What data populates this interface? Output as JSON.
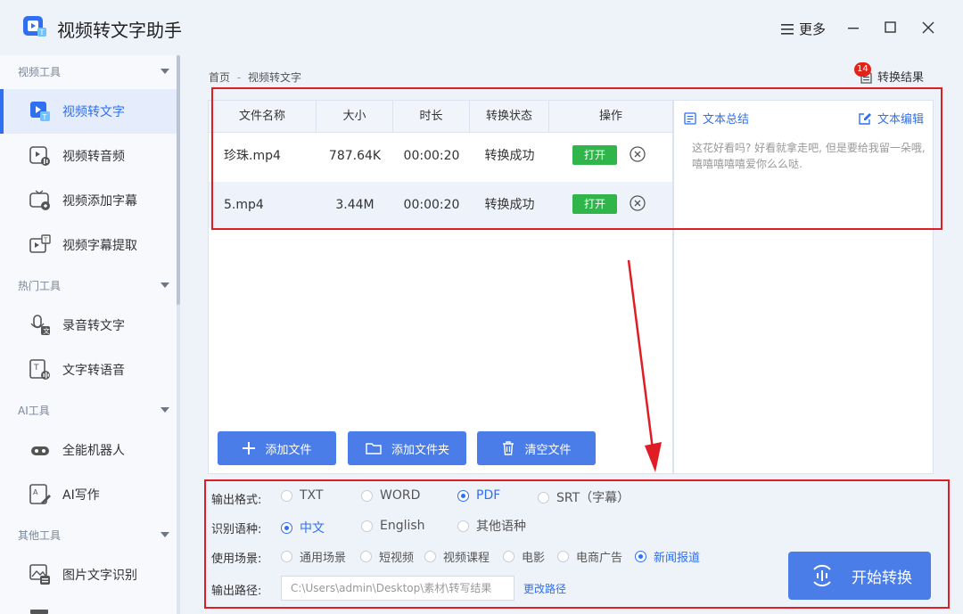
{
  "app": {
    "title": "视频转文字助手",
    "more_label": "更多"
  },
  "sidebar": {
    "sections": [
      {
        "label": "视频工具",
        "items": [
          {
            "label": "视频转文字",
            "icon": "video-to-text-icon",
            "active": true
          },
          {
            "label": "视频转音频",
            "icon": "video-to-audio-icon"
          },
          {
            "label": "视频添加字幕",
            "icon": "add-subtitle-icon"
          },
          {
            "label": "视频字幕提取",
            "icon": "extract-subtitle-icon"
          }
        ]
      },
      {
        "label": "热门工具",
        "items": [
          {
            "label": "录音转文字",
            "icon": "mic-text-icon"
          },
          {
            "label": "文字转语音",
            "icon": "text-speech-icon"
          }
        ]
      },
      {
        "label": "AI工具",
        "items": [
          {
            "label": "全能机器人",
            "icon": "robot-icon"
          },
          {
            "label": "AI写作",
            "icon": "ai-writing-icon"
          }
        ]
      },
      {
        "label": "其他工具",
        "items": [
          {
            "label": "图片文字识别",
            "icon": "image-ocr-icon"
          }
        ]
      }
    ]
  },
  "breadcrumb": {
    "home": "首页",
    "sep": "-",
    "current": "视频转文字"
  },
  "results": {
    "label": "转换结果",
    "count": "14"
  },
  "table": {
    "headers": [
      "文件名称",
      "大小",
      "时长",
      "转换状态",
      "操作"
    ],
    "rows": [
      {
        "name": "珍珠.mp4",
        "size": "787.64K",
        "duration": "00:00:20",
        "status": "转换成功",
        "open": "打开"
      },
      {
        "name": "5.mp4",
        "size": "3.44M",
        "duration": "00:00:20",
        "status": "转换成功",
        "open": "打开"
      }
    ]
  },
  "actions": {
    "add_file": "添加文件",
    "add_folder": "添加文件夹",
    "clear": "清空文件"
  },
  "summary": {
    "title": "文本总结",
    "edit": "文本编辑",
    "text": "这花好看吗? 好看就拿走吧, 但是要给我留一朵哦, 嘻嘻嘻嘻嘻爱你么么哒."
  },
  "settings": {
    "format_label": "输出格式:",
    "formats": [
      "TXT",
      "WORD",
      "PDF",
      "SRT（字幕）"
    ],
    "format_selected": 2,
    "lang_label": "识别语种:",
    "langs": [
      "中文",
      "English",
      "其他语种"
    ],
    "lang_selected": 0,
    "scene_label": "使用场景:",
    "scenes": [
      "通用场景",
      "短视频",
      "视频课程",
      "电影",
      "电商广告",
      "新闻报道"
    ],
    "scene_selected": 5,
    "path_label": "输出路径:",
    "path_value": "C:\\Users\\admin\\Desktop\\素材\\转写结果",
    "change_path": "更改路径"
  },
  "start_button": "开始转换",
  "colors": {
    "accent": "#2f6ff2",
    "highlight": "#e01d24",
    "success": "#2fb54a"
  }
}
